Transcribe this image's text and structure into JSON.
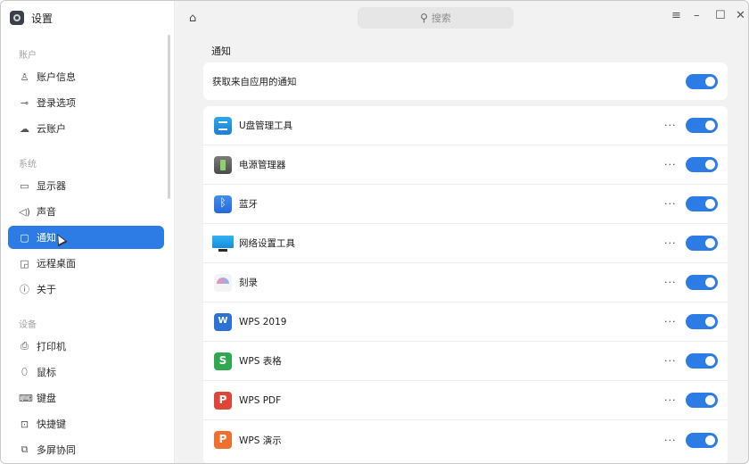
{
  "app": {
    "title": "设置"
  },
  "sidebar": {
    "sections": [
      {
        "label": "账户"
      },
      {
        "label": "系统"
      },
      {
        "label": "设备"
      }
    ],
    "items": [
      {
        "label": "账户信息",
        "icon": "user-icon"
      },
      {
        "label": "登录选项",
        "icon": "key-icon"
      },
      {
        "label": "云账户",
        "icon": "cloud-account-icon"
      },
      {
        "label": "显示器",
        "icon": "monitor-icon"
      },
      {
        "label": "声音",
        "icon": "speaker-icon"
      },
      {
        "label": "通知",
        "icon": "notification-icon",
        "active": true
      },
      {
        "label": "远程桌面",
        "icon": "remote-desktop-icon"
      },
      {
        "label": "关于",
        "icon": "info-icon"
      },
      {
        "label": "打印机",
        "icon": "printer-icon"
      },
      {
        "label": "鼠标",
        "icon": "mouse-icon"
      },
      {
        "label": "键盘",
        "icon": "keyboard-icon"
      },
      {
        "label": "快捷键",
        "icon": "shortcut-icon"
      },
      {
        "label": "多屏协同",
        "icon": "multi-screen-icon"
      }
    ]
  },
  "titlebar": {
    "search_placeholder": "搜索",
    "menu_icon": "menu-icon",
    "minimize_icon": "minimize-icon",
    "maximize_icon": "maximize-icon",
    "close_icon": "close-icon"
  },
  "main": {
    "title": "通知",
    "global_toggle": {
      "label": "获取来自应用的通知",
      "on": true
    },
    "more_label": "···",
    "apps": [
      {
        "name": "U盘管理工具",
        "icon": "usb-manager-icon",
        "on": true
      },
      {
        "name": "电源管理器",
        "icon": "power-manager-icon",
        "on": true
      },
      {
        "name": "蓝牙",
        "icon": "bluetooth-icon",
        "on": true
      },
      {
        "name": "网络设置工具",
        "icon": "network-settings-icon",
        "on": true
      },
      {
        "name": "刻录",
        "icon": "burner-icon",
        "on": true
      },
      {
        "name": "WPS 2019",
        "icon": "wps-writer-icon",
        "on": true
      },
      {
        "name": "WPS 表格",
        "icon": "wps-sheet-icon",
        "on": true
      },
      {
        "name": "WPS PDF",
        "icon": "wps-pdf-icon",
        "on": true
      },
      {
        "name": "WPS 演示",
        "icon": "wps-presentation-icon",
        "on": true
      }
    ]
  },
  "colors": {
    "accent": "#2d7be5",
    "background": "#f2f2f2"
  }
}
